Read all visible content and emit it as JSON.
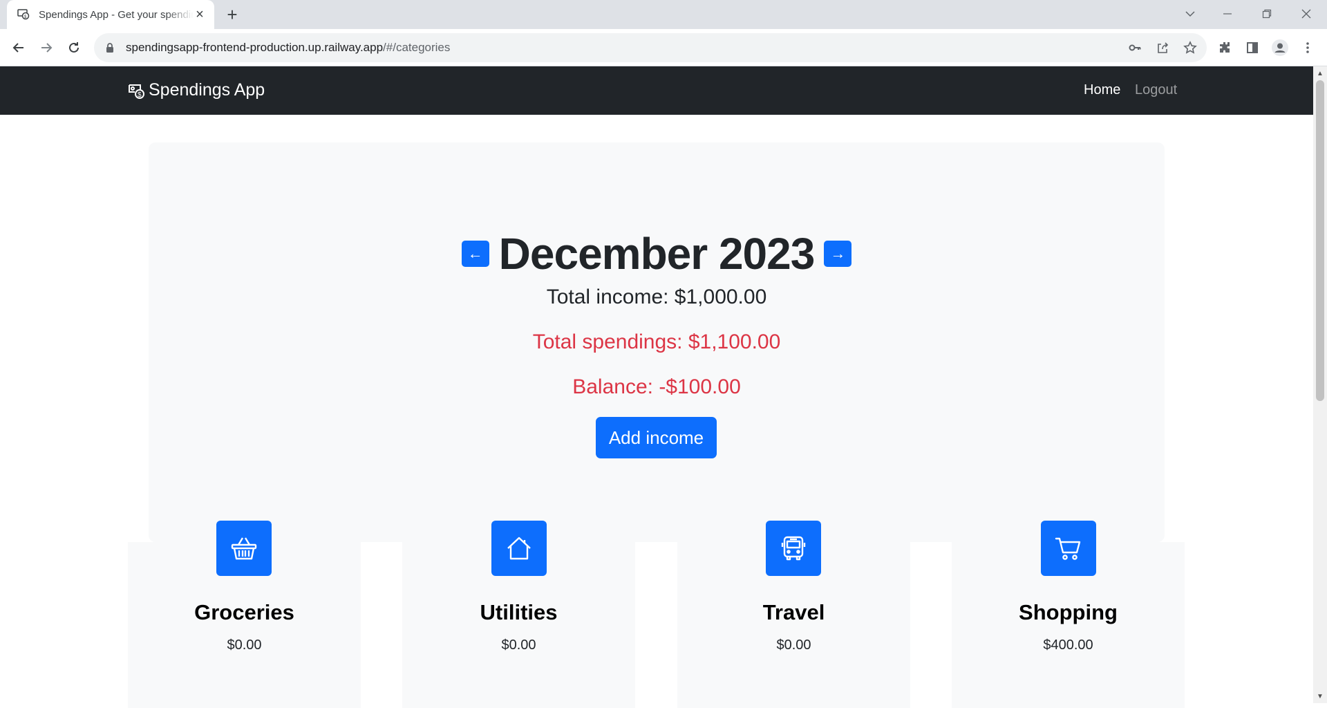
{
  "browser": {
    "tab_title": "Spendings App - Get your spendings",
    "url_host": "spendingsapp-frontend-production.up.railway.app",
    "url_path": "/#/categories"
  },
  "app": {
    "brand": "Spendings App",
    "nav": {
      "home": "Home",
      "logout": "Logout"
    }
  },
  "summary": {
    "month_title": "December 2023",
    "prev_label": "←",
    "next_label": "→",
    "total_income": "Total income: $1,000.00",
    "total_spendings": "Total spendings: $1,100.00",
    "balance": "Balance: -$100.00",
    "add_income_label": "Add income"
  },
  "categories": [
    {
      "name": "Groceries",
      "amount": "$0.00",
      "icon": "basket-icon"
    },
    {
      "name": "Utilities",
      "amount": "$0.00",
      "icon": "house-icon"
    },
    {
      "name": "Travel",
      "amount": "$0.00",
      "icon": "bus-icon"
    },
    {
      "name": "Shopping",
      "amount": "$400.00",
      "icon": "cart-icon"
    }
  ],
  "colors": {
    "primary": "#0d6efd",
    "danger": "#dc3545",
    "navbar": "#212529",
    "card_bg": "#f8f9fa"
  }
}
